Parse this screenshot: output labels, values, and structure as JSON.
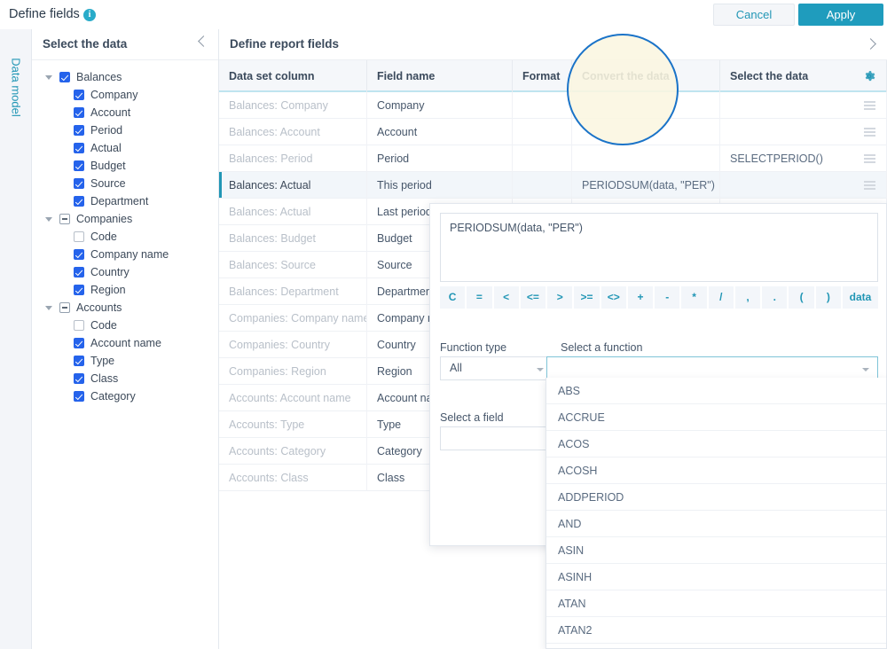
{
  "topbar": {
    "title": "Define fields",
    "info_icon": "info-icon",
    "cancel_label": "Cancel",
    "apply_label": "Apply"
  },
  "rail": {
    "label": "Data model"
  },
  "tree_panel": {
    "title": "Select the data",
    "collapse_icon": "chevron-left-icon",
    "items": [
      {
        "label": "Balances",
        "level": 0,
        "state": "checked",
        "twisty": true
      },
      {
        "label": "Company",
        "level": 1,
        "state": "checked",
        "twisty": false
      },
      {
        "label": "Account",
        "level": 1,
        "state": "checked",
        "twisty": false
      },
      {
        "label": "Period",
        "level": 1,
        "state": "checked",
        "twisty": false
      },
      {
        "label": "Actual",
        "level": 1,
        "state": "checked",
        "twisty": false
      },
      {
        "label": "Budget",
        "level": 1,
        "state": "checked",
        "twisty": false
      },
      {
        "label": "Source",
        "level": 1,
        "state": "checked",
        "twisty": false
      },
      {
        "label": "Department",
        "level": 1,
        "state": "checked",
        "twisty": false
      },
      {
        "label": "Companies",
        "level": 0,
        "state": "indeterminate",
        "twisty": true
      },
      {
        "label": "Code",
        "level": 1,
        "state": "unchecked",
        "twisty": false
      },
      {
        "label": "Company name",
        "level": 1,
        "state": "checked",
        "twisty": false
      },
      {
        "label": "Country",
        "level": 1,
        "state": "checked",
        "twisty": false
      },
      {
        "label": "Region",
        "level": 1,
        "state": "checked",
        "twisty": false
      },
      {
        "label": "Accounts",
        "level": 0,
        "state": "indeterminate",
        "twisty": true
      },
      {
        "label": "Code",
        "level": 1,
        "state": "unchecked",
        "twisty": false
      },
      {
        "label": "Account name",
        "level": 1,
        "state": "checked",
        "twisty": false
      },
      {
        "label": "Type",
        "level": 1,
        "state": "checked",
        "twisty": false
      },
      {
        "label": "Class",
        "level": 1,
        "state": "checked",
        "twisty": false
      },
      {
        "label": "Category",
        "level": 1,
        "state": "checked",
        "twisty": false
      }
    ]
  },
  "main": {
    "title": "Define report fields",
    "expand_icon": "chevron-right-icon",
    "settings_icon": "gear-icon",
    "columns": [
      {
        "label": "Data set column"
      },
      {
        "label": "Field name"
      },
      {
        "label": "Format"
      },
      {
        "label": "Convert the data"
      },
      {
        "label": "Select the data"
      }
    ],
    "rows": [
      {
        "source": "Balances: Company",
        "field": "Company",
        "format": "",
        "convert": "",
        "select": "",
        "selected": false
      },
      {
        "source": "Balances: Account",
        "field": "Account",
        "format": "",
        "convert": "",
        "select": "",
        "selected": false
      },
      {
        "source": "Balances: Period",
        "field": "Period",
        "format": "",
        "convert": "",
        "select": "SELECTPERIOD()",
        "selected": false
      },
      {
        "source": "Balances: Actual",
        "field": "This period",
        "format": "",
        "convert": "PERIODSUM(data, \"PER\")",
        "select": "",
        "selected": true
      },
      {
        "source": "Balances: Actual",
        "field": "Last period",
        "format": "",
        "convert": "",
        "select": "",
        "selected": false
      },
      {
        "source": "Balances: Budget",
        "field": "Budget",
        "format": "",
        "convert": "",
        "select": "",
        "selected": false
      },
      {
        "source": "Balances: Source",
        "field": "Source",
        "format": "",
        "convert": "",
        "select": "",
        "selected": false
      },
      {
        "source": "Balances: Department",
        "field": "Department",
        "format": "",
        "convert": "",
        "select": "",
        "selected": false
      },
      {
        "source": "Companies: Company name",
        "field": "Company name",
        "format": "",
        "convert": "",
        "select": "",
        "selected": false
      },
      {
        "source": "Companies: Country",
        "field": "Country",
        "format": "",
        "convert": "",
        "select": "",
        "selected": false
      },
      {
        "source": "Companies: Region",
        "field": "Region",
        "format": "",
        "convert": "",
        "select": "",
        "selected": false
      },
      {
        "source": "Accounts: Account name",
        "field": "Account name",
        "format": "",
        "convert": "",
        "select": "",
        "selected": false
      },
      {
        "source": "Accounts: Type",
        "field": "Type",
        "format": "",
        "convert": "",
        "select": "",
        "selected": false
      },
      {
        "source": "Accounts: Category",
        "field": "Category",
        "format": "",
        "convert": "",
        "select": "",
        "selected": false
      },
      {
        "source": "Accounts: Class",
        "field": "Class",
        "format": "",
        "convert": "",
        "select": "",
        "selected": false
      }
    ]
  },
  "annotation": {
    "target": "Convert the data",
    "ring_color": "#1a73c8",
    "fill_color": "#faf6e0"
  },
  "popup": {
    "formula": "PERIODSUM(data, \"PER\")",
    "operators": [
      "C",
      "=",
      "<",
      "<=",
      ">",
      ">=",
      "<>",
      "+",
      "-",
      "*",
      "/",
      ",",
      ".",
      "(",
      ")",
      "data"
    ],
    "function_type_label": "Function type",
    "function_type_value": "All",
    "select_function_label": "Select a function",
    "select_function_value": "",
    "select_field_label": "Select a field",
    "select_field_value": "",
    "function_options": [
      "ABS",
      "ACCRUE",
      "ACOS",
      "ACOSH",
      "ADDPERIOD",
      "AND",
      "ASIN",
      "ASINH",
      "ATAN",
      "ATAN2"
    ]
  }
}
